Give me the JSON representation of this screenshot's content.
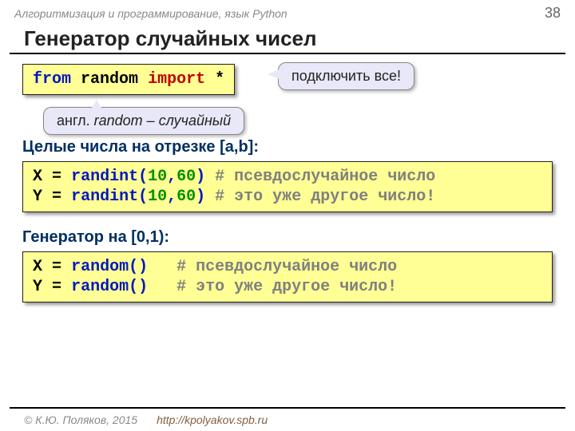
{
  "header": {
    "course": "Алгоритмизация и программирование, язык Python",
    "page": "38"
  },
  "title": "Генератор случайных чисел",
  "importLine": {
    "from": "from",
    "mod": "random",
    "imp": "import",
    "star": "*"
  },
  "callout1": "подключить все!",
  "callout2": {
    "prefix": "англ. ",
    "word": "random",
    "dash": " – ",
    "meaning": "случайный"
  },
  "section1": "Целые числа на отрезке [a,b]:",
  "block1": {
    "l1": {
      "var": "X",
      "eq": "=",
      "fn": "randint",
      "args_open": "(",
      "a": "10",
      "c": ",",
      "b": "60",
      "args_close": ")",
      "cm": "# псевдослучайное число"
    },
    "l2": {
      "var": "Y",
      "eq": "=",
      "fn": "randint",
      "args_open": "(",
      "a": "10",
      "c": ",",
      "b": "60",
      "args_close": ")",
      "cm": "# это уже другое число!"
    }
  },
  "section2": "Генератор на [0,1):",
  "block2": {
    "l1": {
      "var": "X",
      "eq": "=",
      "fn": "random",
      "paren": "()",
      "cm": "# псевдослучайное число"
    },
    "l2": {
      "var": "Y",
      "eq": "=",
      "fn": "random",
      "paren": "()",
      "cm": "# это уже другое число!"
    }
  },
  "footer": {
    "copy": "© К.Ю. Поляков, 2015",
    "url": "http://kpolyakov.spb.ru"
  }
}
